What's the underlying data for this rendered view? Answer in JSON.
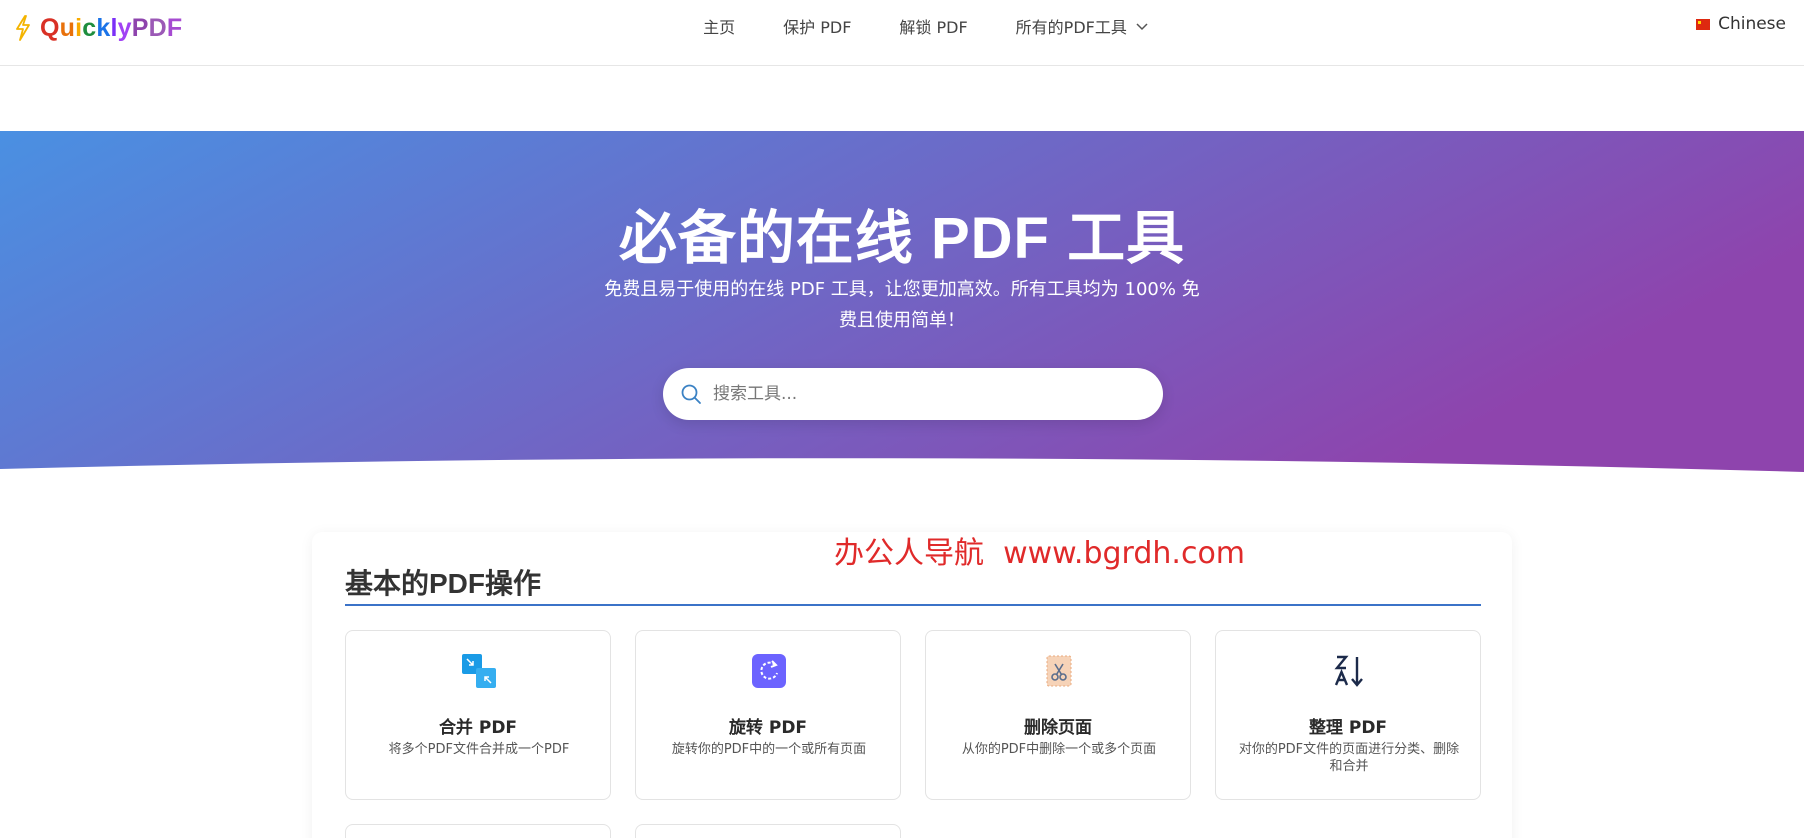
{
  "header": {
    "logo": {
      "icon": "lightning-bolt-icon",
      "letters": [
        {
          "ch": "Q",
          "color": "#d93025"
        },
        {
          "ch": "u",
          "color": "#e8710a"
        },
        {
          "ch": "i",
          "color": "#f9ab00"
        },
        {
          "ch": "c",
          "color": "#1e8e3e"
        },
        {
          "ch": "k",
          "color": "#1a73e8"
        },
        {
          "ch": "l",
          "color": "#7b2ff7"
        },
        {
          "ch": "y",
          "color": "#a142f4"
        },
        {
          "ch": "P",
          "color": "#8e44ad"
        },
        {
          "ch": "D",
          "color": "#9b59b6"
        },
        {
          "ch": "F",
          "color": "#a64bd1"
        }
      ]
    },
    "nav": [
      {
        "label": "主页"
      },
      {
        "label": "保护 PDF"
      },
      {
        "label": "解锁 PDF"
      },
      {
        "label": "所有的PDF工具",
        "icon": "chevron-down-icon"
      }
    ],
    "language": {
      "label": "Chinese",
      "icon": "china-flag-icon"
    }
  },
  "hero": {
    "title": "必备的在线 PDF 工具",
    "subtitle": "免费且易于使用的在线 PDF 工具，让您更加高效。所有工具均为 100% 免费且使用简单！",
    "search": {
      "placeholder": "搜索工具...",
      "value": "",
      "icon": "search-icon"
    },
    "gradient": {
      "from": "#4a90e2",
      "to": "#8e44ad"
    }
  },
  "watermark": "办公人导航  www.bgrdh.com",
  "section": {
    "title": "基本的PDF操作",
    "tools": [
      {
        "name": "合并 PDF",
        "desc": "将多个PDF文件合并成一个PDF",
        "icon": "merge-icon",
        "color": "#1a9be6"
      },
      {
        "name": "旋转 PDF",
        "desc": "旋转你的PDF中的一个或所有页面",
        "icon": "rotate-icon",
        "color": "#6c63ff"
      },
      {
        "name": "删除页面",
        "desc": "从你的PDF中删除一个或多个页面",
        "icon": "scissors-page-icon",
        "color": "#f0b48a"
      },
      {
        "name": "整理 PDF",
        "desc": "对你的PDF文件的页面进行分类、删除和合并",
        "icon": "sort-za-icon",
        "color": "#1c2a4a"
      }
    ]
  },
  "colors": {
    "accent_line": "#3b73c8",
    "watermark": "#e02a2a"
  }
}
